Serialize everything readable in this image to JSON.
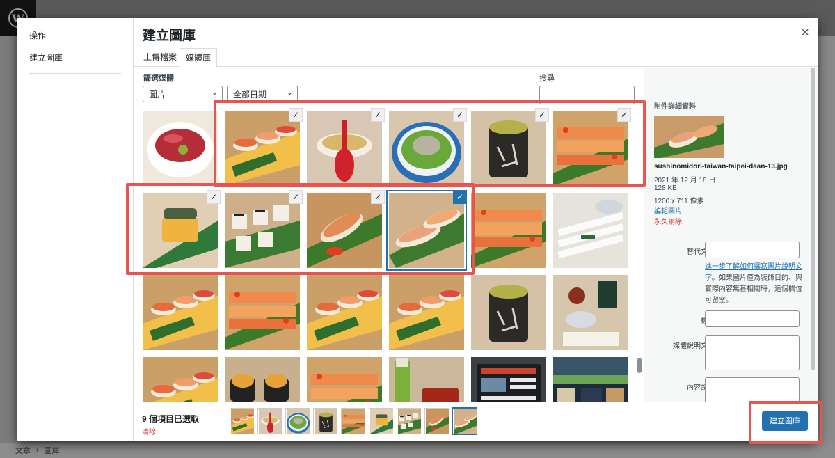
{
  "background": {
    "wp_logo": "W",
    "footer_breadcrumb": [
      "文章",
      "圖庫"
    ],
    "footer_sep": "›"
  },
  "menu": {
    "items": [
      "操作",
      "建立圖庫"
    ]
  },
  "modal": {
    "title": "建立圖庫",
    "close_glyph": "×",
    "tabs": [
      "上傳檔案",
      "媒體庫"
    ],
    "active_tab": "媒體庫"
  },
  "toolbar": {
    "filter_label": "篩選媒體",
    "type_select": "圖片",
    "date_select": "全部日期",
    "search_label": "搜尋",
    "chevron": "⌄"
  },
  "grid": {
    "check_glyph": "✓",
    "tiles": [
      {
        "kind": "tuna",
        "selected": false
      },
      {
        "kind": "sushi",
        "selected": true
      },
      {
        "kind": "spoon",
        "selected": true
      },
      {
        "kind": "salad",
        "selected": true
      },
      {
        "kind": "tea",
        "selected": true
      },
      {
        "kind": "salmon",
        "selected": true
      },
      {
        "kind": "tamago",
        "selected": true
      },
      {
        "kind": "rolls",
        "selected": true
      },
      {
        "kind": "aburi",
        "selected": true
      },
      {
        "kind": "aburi2",
        "selected": true,
        "details": true
      },
      {
        "kind": "salmon",
        "selected": false
      },
      {
        "kind": "chopsticks",
        "selected": false
      },
      {
        "kind": "sushi",
        "selected": false
      },
      {
        "kind": "salmon",
        "selected": false
      },
      {
        "kind": "sushi",
        "selected": false
      },
      {
        "kind": "sushi",
        "selected": false
      },
      {
        "kind": "tea",
        "selected": false
      },
      {
        "kind": "plate",
        "selected": false
      },
      {
        "kind": "sushi",
        "selected": false
      },
      {
        "kind": "uni",
        "selected": false
      },
      {
        "kind": "salmon",
        "selected": false
      },
      {
        "kind": "bottle",
        "selected": false
      },
      {
        "kind": "screen",
        "selected": false
      },
      {
        "kind": "shop",
        "selected": false
      }
    ]
  },
  "details": {
    "heading": "附件詳細資料",
    "filename": "sushinomidori-taiwan-taipei-daan-13.jpg",
    "date": "2021 年 12 月 18 日",
    "size": "128 KB",
    "dimensions": "1200 x 711 像素",
    "edit_link": "編輯圖片",
    "delete_link": "永久刪除",
    "alt_label": "替代文字",
    "alt_help_link": "進一步了解如何撰寫圖片說明文字",
    "alt_help_text": "。如果圖片僅為裝飾目的、與實際內容無甚相關時，這個欄位可留空。",
    "title_label": "標題",
    "caption_label": "媒體說明文字",
    "description_label": "內容說明"
  },
  "bottom": {
    "selected_count": "9 個項目已選取",
    "clear": "清除",
    "create_button": "建立圖庫"
  },
  "colors": {
    "accent": "#2271b1",
    "highlight": "#e85550",
    "danger": "#d63638"
  }
}
